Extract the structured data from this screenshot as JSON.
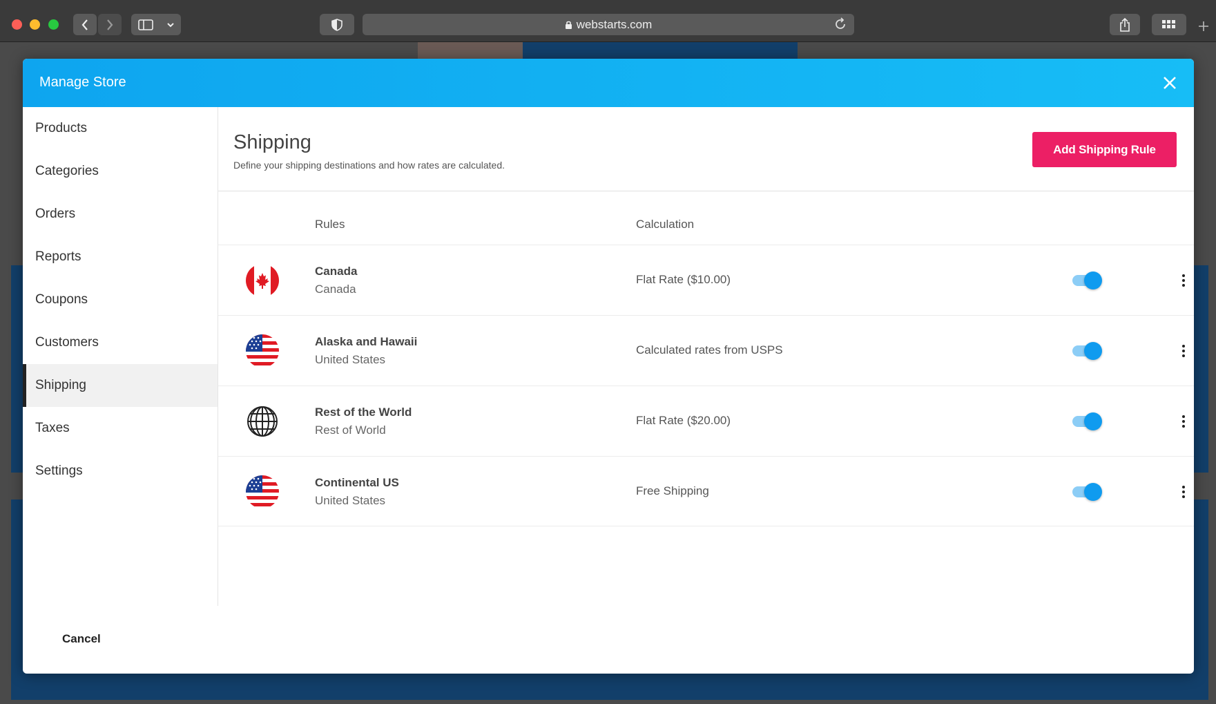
{
  "browser": {
    "url": "webstarts.com"
  },
  "modal": {
    "title": "Manage Store",
    "cancel_label": "Cancel"
  },
  "sidebar": {
    "items": [
      {
        "label": "Products",
        "active": false
      },
      {
        "label": "Categories",
        "active": false
      },
      {
        "label": "Orders",
        "active": false
      },
      {
        "label": "Reports",
        "active": false
      },
      {
        "label": "Coupons",
        "active": false
      },
      {
        "label": "Customers",
        "active": false
      },
      {
        "label": "Shipping",
        "active": true
      },
      {
        "label": "Taxes",
        "active": false
      },
      {
        "label": "Settings",
        "active": false
      }
    ]
  },
  "main": {
    "title": "Shipping",
    "subtitle": "Define your shipping destinations and how rates are calculated.",
    "add_button_label": "Add Shipping Rule",
    "columns": [
      "Rules",
      "Calculation"
    ],
    "rules": [
      {
        "name": "Canada",
        "region": "Canada",
        "calculation": "Flat Rate ($10.00)",
        "icon": "canada-flag-icon",
        "enabled": true
      },
      {
        "name": "Alaska and Hawaii",
        "region": "United States",
        "calculation": "Calculated rates from USPS",
        "icon": "us-flag-icon",
        "enabled": true
      },
      {
        "name": "Rest of the World",
        "region": "Rest of World",
        "calculation": "Flat Rate ($20.00)",
        "icon": "globe-icon",
        "enabled": true
      },
      {
        "name": "Continental US",
        "region": "United States",
        "calculation": "Free Shipping",
        "icon": "us-flag-icon",
        "enabled": true
      }
    ]
  },
  "colors": {
    "header": "#0ea5ef",
    "accent_button": "#ec1f65",
    "toggle_on": "#0f9bef"
  }
}
